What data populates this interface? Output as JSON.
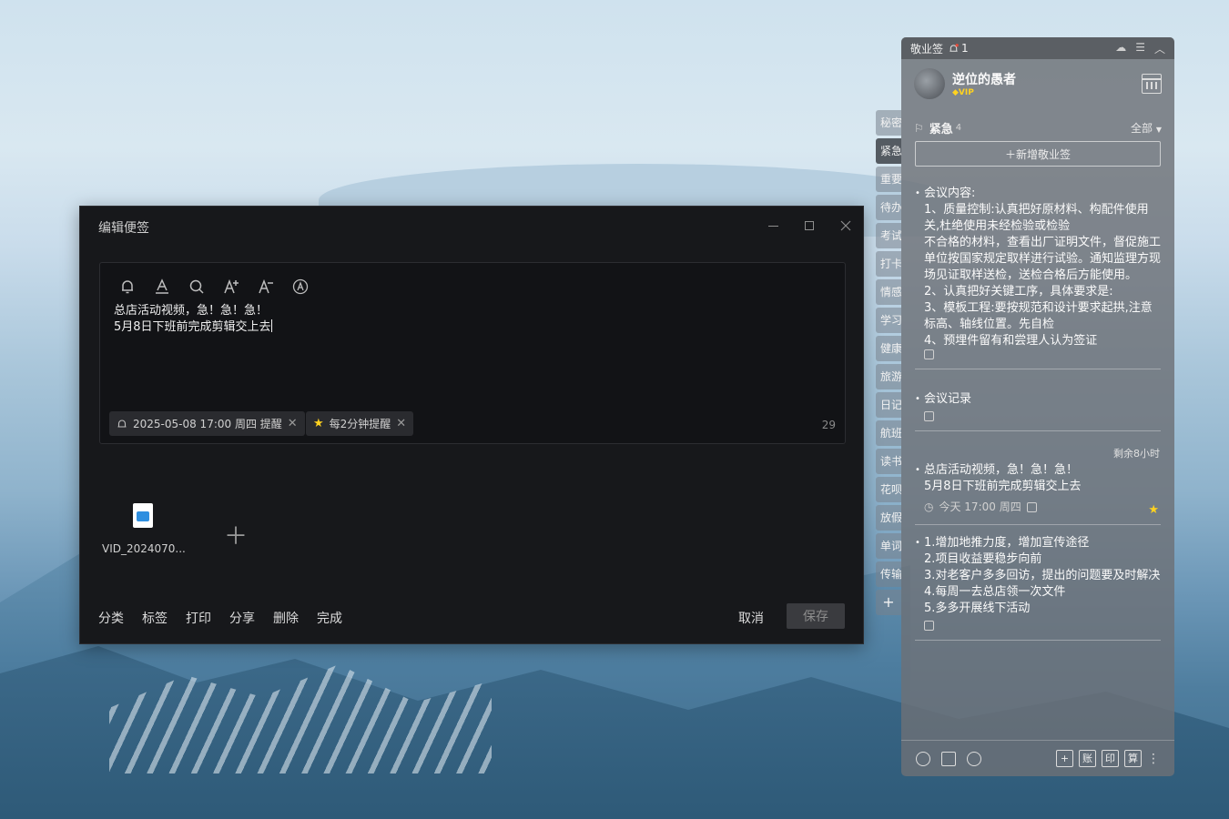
{
  "editor": {
    "title": "编辑便签",
    "content_lines": [
      "总店活动视频，急！急！急！",
      "5月8日下班前完成剪辑交上去"
    ],
    "chips": [
      {
        "label": "2025-05-08 17:00 周四 提醒",
        "icon": "bell-icon"
      },
      {
        "label": "每2分钟提醒",
        "icon": "star-icon"
      }
    ],
    "char_count": "29",
    "attachment_name": "VID_2024070...",
    "actions": [
      "分类",
      "标签",
      "打印",
      "分享",
      "删除",
      "完成"
    ],
    "cancel_label": "取消",
    "save_label": "保存"
  },
  "side_tabs": [
    "秘密",
    "紧急",
    "重要",
    "待办",
    "考试",
    "打卡",
    "情感",
    "学习",
    "健康",
    "旅游",
    "日记",
    "航班",
    "读书",
    "花呗",
    "放假",
    "单词",
    "传输"
  ],
  "panel": {
    "app_title": "敬业签",
    "bell_count": "1",
    "user_name": "逆位的愚者",
    "vip_label": "VIP",
    "category": "紧急",
    "category_count": "4",
    "filter_label": "全部",
    "new_note_label": "新增敬业签",
    "remaining_label": "剩余8小时",
    "notes": [
      {
        "text": "会议内容:\n1、质量控制:认真把好原材料、构配件使用关,杜绝使用未经检验或检验\n不合格的材料，查看出厂证明文件，督促施工单位按国家规定取样进行试验。通知监理方现场见证取样送检，送检合格后方能使用。\n2、认真把好关键工序，具体要求是:\n3、模板工程:要按规范和设计要求起拱,注意标高、轴线位置。先自检\n4、预埋件留有和尝理人认为签证"
      },
      {
        "text": "会议记录"
      },
      {
        "text": "总店活动视频，急！急！急！\n5月8日下班前完成剪辑交上去",
        "time": "今天 17:00 周四"
      },
      {
        "text": "1.增加地推力度，增加宣传途径\n2.项目收益要稳步向前\n3.对老客户多多回访，提出的问题要及时解决\n4.每周一去总店领一次文件\n5.多多开展线下活动"
      }
    ],
    "footer_boxes": [
      "+",
      "账",
      "印",
      "算"
    ]
  },
  "colors": {
    "editor_bg": "#17181b",
    "panel_bg": "#6c7076",
    "vip_gold": "#ffd21f",
    "attachment_blue": "#2f8fe0"
  }
}
